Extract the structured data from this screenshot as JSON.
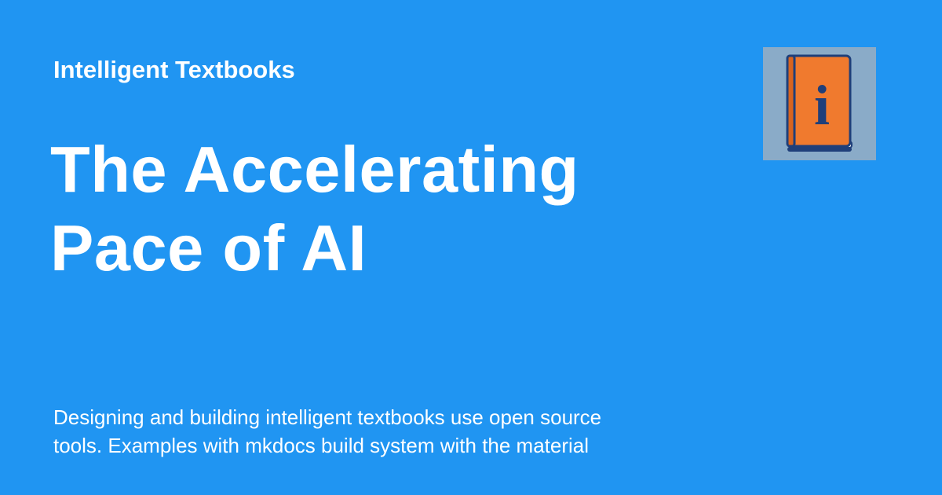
{
  "site": {
    "name": "Intelligent Textbooks"
  },
  "page": {
    "title": "The Accelerating Pace of AI",
    "description": "Designing and building intelligent textbooks use open source\ntools.  Examples with mkdocs build system with the material"
  },
  "logo": {
    "icon": "book-info-icon",
    "glyph": "i"
  },
  "colors": {
    "background": "#2095F2",
    "text": "#FFFFFF",
    "logo_background": "#8AABC8",
    "book_cover": "#F07A2E",
    "book_spine": "#1F3F7A"
  }
}
